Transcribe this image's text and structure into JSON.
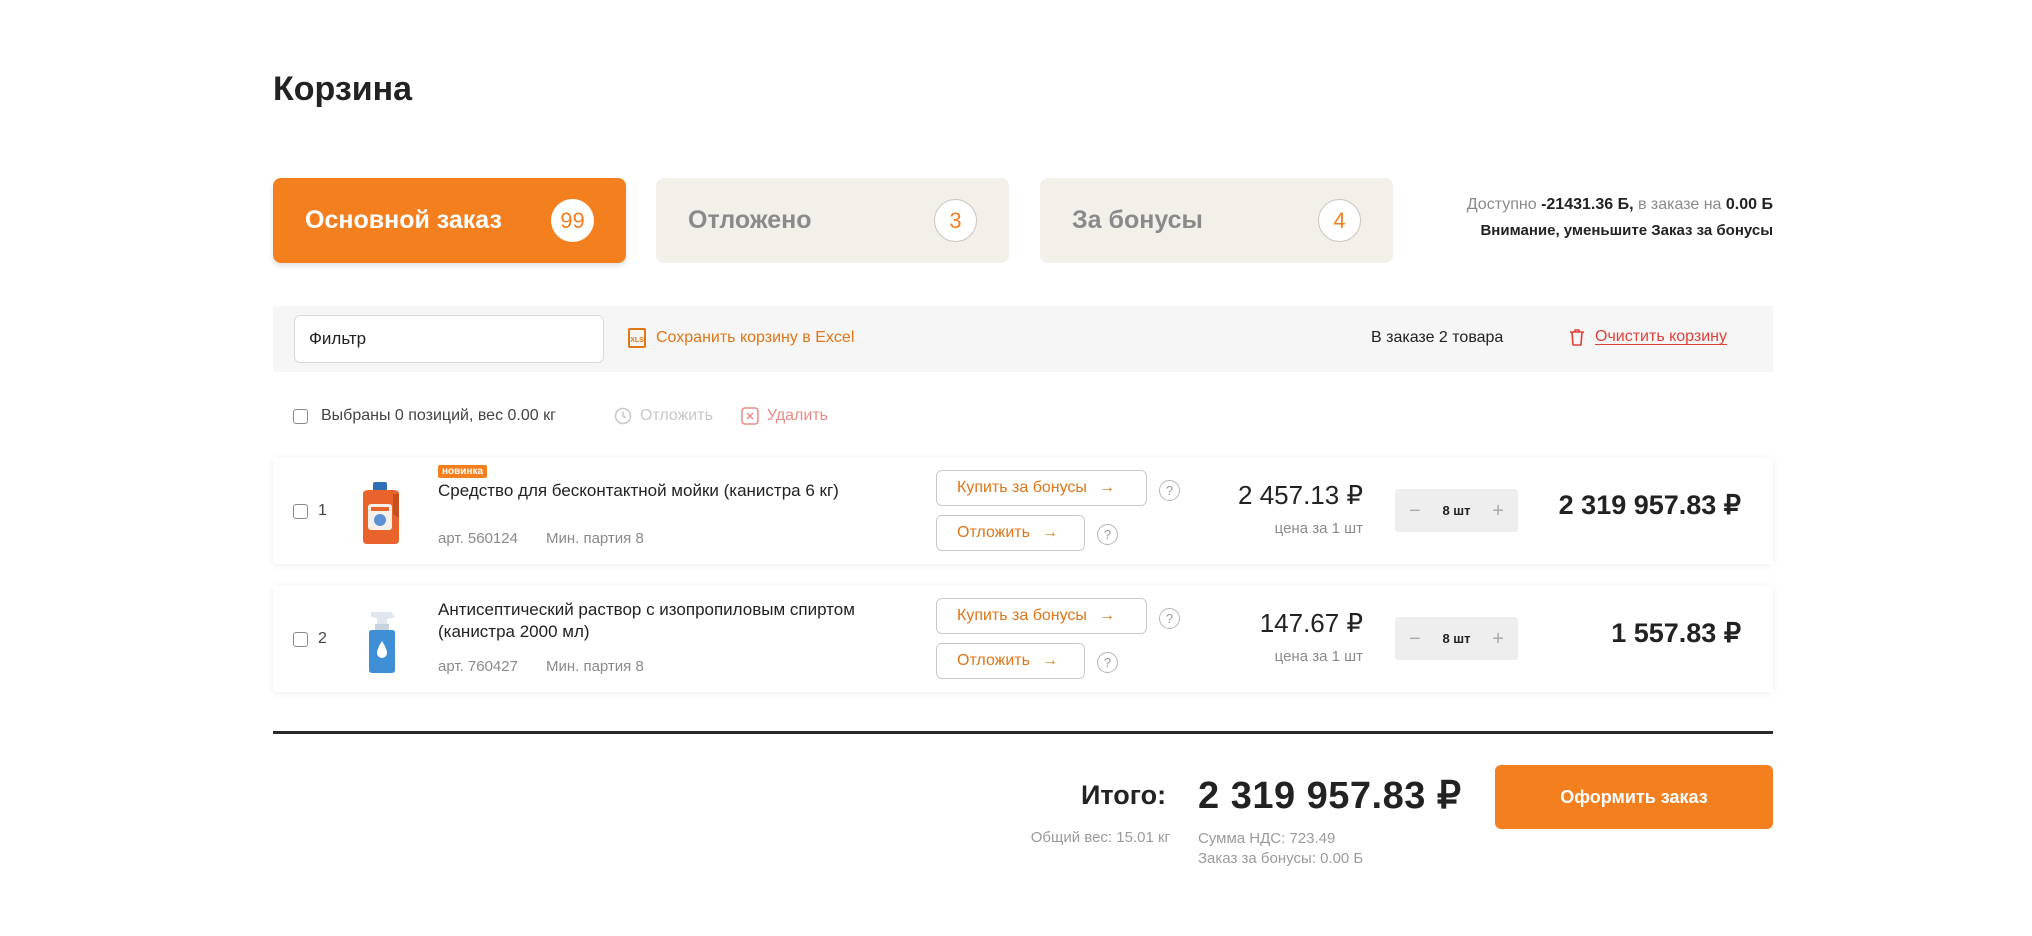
{
  "page": {
    "title": "Корзина"
  },
  "tabs": [
    {
      "label": "Основной заказ",
      "count": "99",
      "active": true
    },
    {
      "label": "Отложено",
      "count": "3",
      "active": false
    },
    {
      "label": "За бонусы",
      "count": "4",
      "active": false
    }
  ],
  "bonus_info": {
    "prefix": "Доступно",
    "available": "-21431.36 Б,",
    "middle": "в заказе на",
    "in_order": "0.00 Б",
    "warning": "Внимание, уменьшите Заказ за бонусы"
  },
  "toolbar": {
    "filter_placeholder": "Фильтр",
    "excel_icon_text": "XLS",
    "excel_label": "Сохранить корзину в Excel",
    "in_order_label": "В заказе 2 товара",
    "clear_label": "Очистить корзину"
  },
  "selection": {
    "summary": "Выбраны 0 позиций, вес 0.00 кг",
    "postpone_label": "Отложить",
    "delete_label": "Удалить"
  },
  "items": [
    {
      "index": "1",
      "badge": "новинка",
      "name": "Средство для бесконтактной мойки (канистра 6 кг)",
      "article": "арт. 560124",
      "min_batch": "Мин. партия  8",
      "buy_bonus_label": "Купить за бонусы",
      "postpone_label": "Отложить",
      "help": "?",
      "price": "2 457.13 ₽",
      "price_note": "цена за 1 шт",
      "quantity": "8 шт",
      "minus": "−",
      "plus": "+",
      "total": "2 319 957.83 ₽"
    },
    {
      "index": "2",
      "badge": "",
      "name": "Антисептический раствор с изопропиловым спиртом (канистра 2000 мл)",
      "article": "арт. 760427",
      "min_batch": "Мин. партия  8",
      "buy_bonus_label": "Купить за бонусы",
      "postpone_label": "Отложить",
      "help": "?",
      "price": "147.67 ₽",
      "price_note": "цена за 1 шт",
      "quantity": "8 шт",
      "minus": "−",
      "plus": "+",
      "total": "1 557.83 ₽"
    }
  ],
  "summary": {
    "label": "Итого:",
    "value": "2 319 957.83 ₽",
    "weight": "Общий вес: 15.01 кг",
    "vat": "Сумма НДС: 723.49",
    "bonus_order": "Заказ за бонусы: 0.00 Б",
    "checkout_label": "Оформить заказ"
  },
  "colors": {
    "accent": "#f47f1e",
    "danger": "#e0403a",
    "tab_inactive": "#f3efe9"
  }
}
